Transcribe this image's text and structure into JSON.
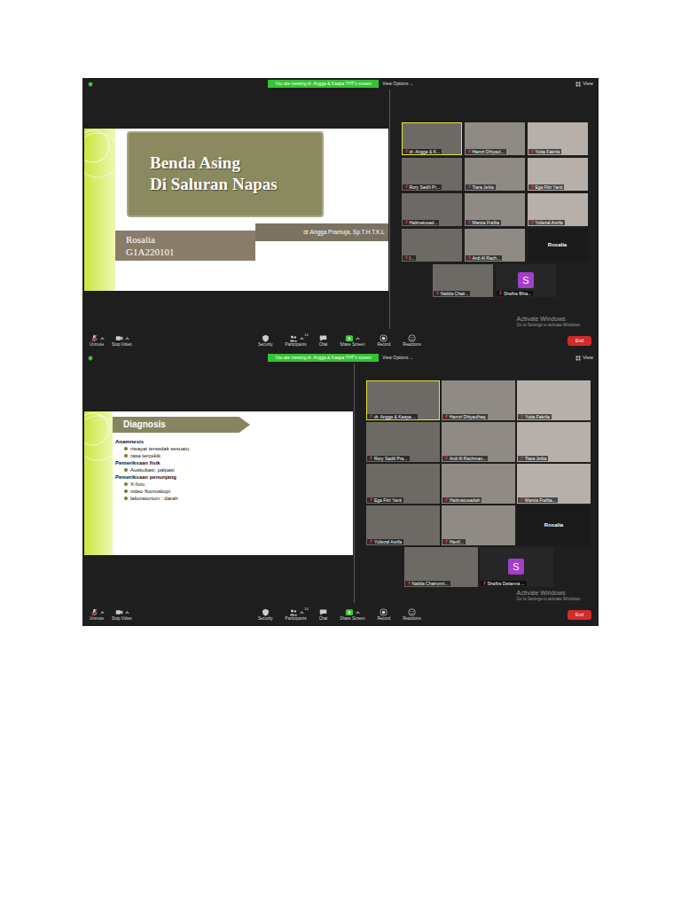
{
  "shots": [
    {
      "banner": "You are viewing dr. Angga & Kaapa THT's screen",
      "view_options": "View Options ⌄",
      "view": "View",
      "slide": {
        "kind": "title",
        "title": [
          "Benda Asing",
          "Di Saluran Napas"
        ],
        "presenter": "dr.Angga Pramuja, Sp.T.H.T.K.L",
        "author": [
          "Rosalia",
          "G1A220101"
        ]
      },
      "participants": [
        {
          "name": "dr. Angga & K...",
          "kind": "video",
          "speaking": true,
          "muted": true
        },
        {
          "name": "Hamzi Dhiyaul...",
          "kind": "video",
          "speaking": false,
          "muted": true
        },
        {
          "name": "Yutta Fakrila",
          "kind": "video",
          "speaking": false,
          "muted": true
        },
        {
          "name": "Rory Sadili Pr...",
          "kind": "video",
          "speaking": false,
          "muted": true
        },
        {
          "name": "Tiara Jelita",
          "kind": "video",
          "speaking": false,
          "muted": true
        },
        {
          "name": "Ega Fitri Yanti",
          "kind": "video",
          "speaking": false,
          "muted": true
        },
        {
          "name": "Halimatusad...",
          "kind": "video",
          "speaking": false,
          "muted": true
        },
        {
          "name": "Marsia Frafita",
          "kind": "video",
          "speaking": false,
          "muted": true
        },
        {
          "name": "Yuliezal Asrifa",
          "kind": "video",
          "speaking": false,
          "muted": true
        },
        {
          "name": "I...",
          "kind": "video",
          "speaking": false,
          "muted": true
        },
        {
          "name": "Ardi Al Rach...",
          "kind": "video",
          "speaking": false,
          "muted": true
        },
        {
          "name": "Rosalia",
          "kind": "name",
          "speaking": false,
          "muted": false
        },
        {
          "name": "Nabila Chair...",
          "kind": "video",
          "speaking": false,
          "muted": true
        },
        {
          "name": "Shafira Bhia...",
          "kind": "avatar",
          "letter": "S",
          "color": "#a33ec9",
          "speaking": false,
          "muted": true
        }
      ],
      "watermark": [
        "Activate Windows",
        "Go to Settings to activate Windows."
      ],
      "toolbar": [
        {
          "label": "Unmute",
          "muted": true
        },
        {
          "label": "Stop Video"
        },
        {
          "label": "Security"
        },
        {
          "label": "Participants",
          "count": "14"
        },
        {
          "label": "Chat"
        },
        {
          "label": "Share Screen"
        },
        {
          "label": "Record"
        },
        {
          "label": "Reactions"
        }
      ],
      "end": "End"
    },
    {
      "banner": "You are viewing dr. Angga & Kaapa THT's screen",
      "view_options": "View Options ⌄",
      "view": "View",
      "slide": {
        "kind": "list",
        "title": "Diagnosis",
        "sections": [
          {
            "heading": "Anamnesis",
            "items": [
              "riwayat tersedak sesuatu",
              "rasa tercekik"
            ]
          },
          {
            "heading": "Pemeriksaan fisik",
            "items": [
              "Auskultasi, palpasi"
            ]
          },
          {
            "heading": "Pemeriksaan penunjang",
            "items": [
              "X-foto",
              "video fluoroskopi",
              "laboratorium : darah"
            ]
          }
        ]
      },
      "participants": [
        {
          "name": "dr. Angga & Kaapa ...",
          "kind": "video",
          "speaking": true,
          "muted": true
        },
        {
          "name": "Hamzi Dhiyaulhaq",
          "kind": "video",
          "speaking": false,
          "muted": true
        },
        {
          "name": "Yutta Fakrila",
          "kind": "video",
          "speaking": false,
          "muted": true
        },
        {
          "name": "Rory Sadili Pra...",
          "kind": "video",
          "speaking": false,
          "muted": true
        },
        {
          "name": "Ardi Al Rachman...",
          "kind": "video",
          "speaking": false,
          "muted": true
        },
        {
          "name": "Tiara Jelita",
          "kind": "video",
          "speaking": false,
          "muted": true
        },
        {
          "name": "Ega Fitri Yanti",
          "kind": "video",
          "speaking": false,
          "muted": true
        },
        {
          "name": "Halimatusadiah",
          "kind": "video",
          "speaking": false,
          "muted": true
        },
        {
          "name": "Marsia Frafita...",
          "kind": "video",
          "speaking": false,
          "muted": true
        },
        {
          "name": "Yuliezal Asrifa",
          "kind": "video",
          "speaking": false,
          "muted": true
        },
        {
          "name": "Hanif...",
          "kind": "video",
          "speaking": false,
          "muted": true
        },
        {
          "name": "Rosalia",
          "kind": "name",
          "speaking": false,
          "muted": false
        },
        {
          "name": "Nabila Chairunni...",
          "kind": "video",
          "speaking": false,
          "muted": true
        },
        {
          "name": "Shafira Dwianna ...",
          "kind": "avatar",
          "letter": "S",
          "color": "#a33ec9",
          "speaking": false,
          "muted": true
        }
      ],
      "watermark": [
        "Activate Windows",
        "Go to Settings to activate Windows."
      ],
      "toolbar": [
        {
          "label": "Unmute",
          "muted": true
        },
        {
          "label": "Stop Video"
        },
        {
          "label": "Security"
        },
        {
          "label": "Participants",
          "count": "14"
        },
        {
          "label": "Chat"
        },
        {
          "label": "Share Screen"
        },
        {
          "label": "Record"
        },
        {
          "label": "Reactions"
        }
      ],
      "end": "End"
    }
  ]
}
